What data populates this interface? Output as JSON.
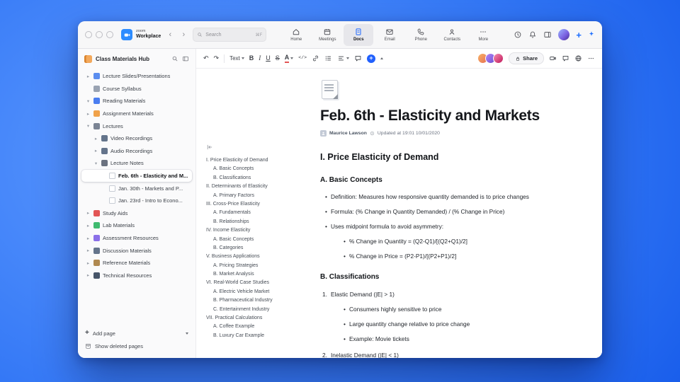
{
  "titlebar": {
    "brand_line1": "zoom",
    "brand_line2": "Workplace",
    "search_placeholder": "Search",
    "search_shortcut": "⌘F"
  },
  "topnav": {
    "tabs": [
      {
        "label": "Home"
      },
      {
        "label": "Meetings"
      },
      {
        "label": "Docs",
        "active": true
      },
      {
        "label": "Email"
      },
      {
        "label": "Phone"
      },
      {
        "label": "Contacts"
      },
      {
        "label": "More"
      }
    ]
  },
  "sidebar": {
    "title": "Class Materials Hub",
    "items": [
      {
        "label": "Lecture Slides/Presentations",
        "level": 0,
        "chevron": "▸",
        "color": "#5b8def",
        "icon": "block"
      },
      {
        "label": "Course Syllabus",
        "level": 0,
        "chevron": "",
        "color": "#9aa3b2",
        "icon": "block"
      },
      {
        "label": "Reading Materials",
        "level": 0,
        "chevron": "▾",
        "color": "#4a7df0",
        "icon": "block"
      },
      {
        "label": "Assignment Materials",
        "level": 0,
        "chevron": "▸",
        "color": "#f0a24a",
        "icon": "block"
      },
      {
        "label": "Lectures",
        "level": 0,
        "chevron": "▾",
        "color": "#7b8494",
        "icon": "block"
      },
      {
        "label": "Video Recordings",
        "level": 1,
        "chevron": "▸",
        "color": "#64748b",
        "icon": "block"
      },
      {
        "label": "Audio Recordings",
        "level": 1,
        "chevron": "▸",
        "color": "#64748b",
        "icon": "block"
      },
      {
        "label": "Lecture Notes",
        "level": 1,
        "chevron": "▾",
        "color": "#6b7280",
        "icon": "block"
      },
      {
        "label": "Feb. 6th - Elasticity and M...",
        "level": 2,
        "chevron": "",
        "icon": "page",
        "selected": true
      },
      {
        "label": "Jan. 30th - Markets and P...",
        "level": 2,
        "chevron": "",
        "icon": "page"
      },
      {
        "label": "Jan. 23rd - Intro to Econo...",
        "level": 2,
        "chevron": "",
        "icon": "page"
      },
      {
        "label": "Study Aids",
        "level": 0,
        "chevron": "▸",
        "color": "#e25555",
        "icon": "block"
      },
      {
        "label": "Lab Materials",
        "level": 0,
        "chevron": "▸",
        "color": "#3fba6f",
        "icon": "block"
      },
      {
        "label": "Assessment Resources",
        "level": 0,
        "chevron": "▸",
        "color": "#8a6fe8",
        "icon": "block"
      },
      {
        "label": "Discussion Materials",
        "level": 0,
        "chevron": "▸",
        "color": "#64748b",
        "icon": "block"
      },
      {
        "label": "Reference Materials",
        "level": 0,
        "chevron": "▸",
        "color": "#b08950",
        "icon": "block"
      },
      {
        "label": "Technical Resources",
        "level": 0,
        "chevron": "▸",
        "color": "#475569",
        "icon": "block"
      }
    ],
    "add_page": "Add page",
    "show_deleted": "Show deleted pages"
  },
  "toolbar": {
    "text_label": "Text",
    "bold": "B",
    "italic": "I",
    "underline": "U",
    "strike": "S",
    "color": "A",
    "code": "</>",
    "share": "Share"
  },
  "document": {
    "title": "Feb. 6th - Elasticity and Markets",
    "author": "Maurice Lawson",
    "updated": "Updated at 19:01 10/01/2020",
    "outline": [
      {
        "t": "I. Price Elasticity of Demand",
        "l": 0
      },
      {
        "t": "A. Basic Concepts",
        "l": 1
      },
      {
        "t": "B. Classifications",
        "l": 1
      },
      {
        "t": "II. Determinants of Elasticity",
        "l": 0
      },
      {
        "t": "A. Primary Factors",
        "l": 1
      },
      {
        "t": "III. Cross-Price Elasticity",
        "l": 0
      },
      {
        "t": "A. Fundamentals",
        "l": 1
      },
      {
        "t": "B. Relationships",
        "l": 1
      },
      {
        "t": "IV. Income Elasticity",
        "l": 0
      },
      {
        "t": "A. Basic Concepts",
        "l": 1
      },
      {
        "t": "B. Categories",
        "l": 1
      },
      {
        "t": "V. Business Applications",
        "l": 0
      },
      {
        "t": "A. Pricing Strategies",
        "l": 1
      },
      {
        "t": "B. Market Analysis",
        "l": 1
      },
      {
        "t": "VI. Real-World Case Studies",
        "l": 0
      },
      {
        "t": "A. Electric Vehicle Market",
        "l": 1
      },
      {
        "t": "B. Pharmaceutical Industry",
        "l": 1
      },
      {
        "t": "C. Entertainment Industry",
        "l": 1
      },
      {
        "t": "VII. Practical Calculations",
        "l": 0
      },
      {
        "t": "A. Coffee Example",
        "l": 1
      },
      {
        "t": "B. Luxury Car Example",
        "l": 1
      }
    ],
    "content": [
      {
        "type": "h2",
        "text": "I. Price Elasticity of Demand"
      },
      {
        "type": "h3",
        "text": "A. Basic Concepts"
      },
      {
        "type": "bullet",
        "level": 1,
        "text": "Definition: Measures how responsive quantity demanded is to price changes"
      },
      {
        "type": "bullet",
        "level": 1,
        "text": "Formula: (% Change in Quantity Demanded) / (% Change in Price)"
      },
      {
        "type": "bullet",
        "level": 1,
        "text": "Uses midpoint formula to avoid asymmetry:"
      },
      {
        "type": "bullet",
        "level": 2,
        "text": "% Change in Quantity = (Q2-Q1)/[(Q2+Q1)/2]"
      },
      {
        "type": "bullet",
        "level": 2,
        "text": "% Change in Price = (P2-P1)/[(P2+P1)/2]"
      },
      {
        "type": "h3",
        "text": "B. Classifications"
      },
      {
        "type": "number",
        "num": "1.",
        "text": "Elastic Demand (|E| > 1)"
      },
      {
        "type": "bullet",
        "level": 2,
        "text": "Consumers highly sensitive to price"
      },
      {
        "type": "bullet",
        "level": 2,
        "text": "Large quantity change relative to price change"
      },
      {
        "type": "bullet",
        "level": 2,
        "text": "Example: Movie tickets"
      },
      {
        "type": "number",
        "num": "2.",
        "text": "Inelastic Demand (|E| < 1)"
      }
    ]
  }
}
